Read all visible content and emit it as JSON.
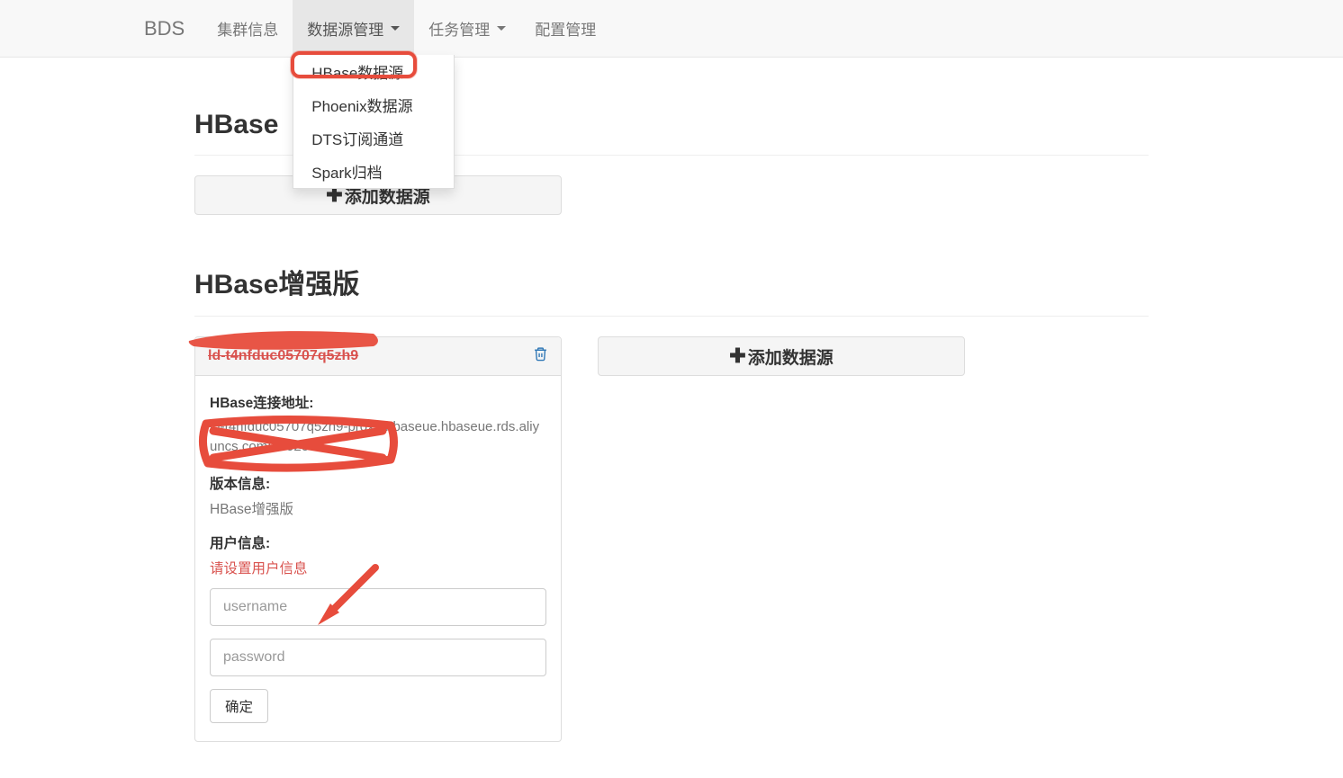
{
  "nav": {
    "brand": "BDS",
    "items": [
      {
        "label": "集群信息"
      },
      {
        "label": "数据源管理",
        "caret": true,
        "active": true
      },
      {
        "label": "任务管理",
        "caret": true
      },
      {
        "label": "配置管理"
      }
    ],
    "dropdown": [
      "HBase数据源",
      "Phoenix数据源",
      "DTS订阅通道",
      "Spark归档"
    ]
  },
  "sections": {
    "hbase": {
      "title": "HBase",
      "add_label": "添加数据源"
    },
    "hbase_plus": {
      "title": "HBase增强版",
      "add_label": "添加数据源",
      "card": {
        "name": "ld-t4nfduc05707q5zh9",
        "conn_label": "HBase连接地址:",
        "conn_value": "ld-t4nfduc05707q5zh9-proxy-hbaseue.hbaseue.rds.aliyuncs.com:30020",
        "version_label": "版本信息:",
        "version_value": "HBase增强版",
        "user_label": "用户信息:",
        "user_warning": "请设置用户信息",
        "username_placeholder": "username",
        "password_placeholder": "password",
        "confirm_label": "确定"
      }
    }
  }
}
